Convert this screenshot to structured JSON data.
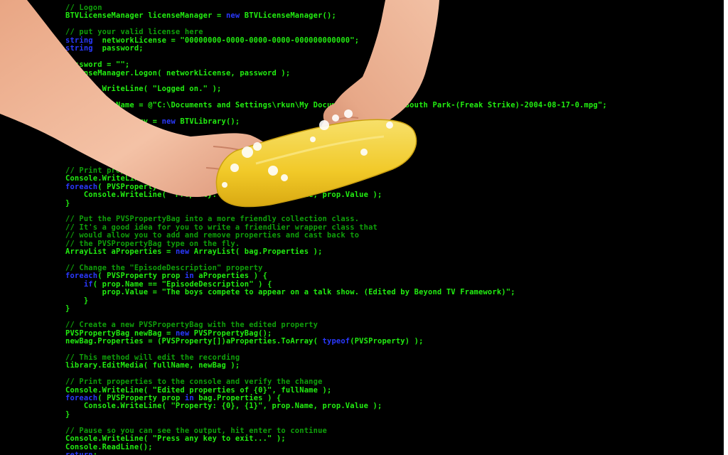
{
  "colors": {
    "background": "#000000",
    "keyword": "#2a39ff",
    "identifier": "#22ee11",
    "comment": "#0fa10a",
    "skin": "#f1b89a",
    "sponge": "#f3d23a"
  },
  "illustration": {
    "hands_icon": "hands-icon",
    "sponge_icon": "sponge-icon",
    "foam_icon": "foam-icon"
  },
  "code_lines": [
    [
      [
        "cm",
        "// Logon"
      ]
    ],
    [
      [
        "id",
        "BTVLicenseManager licenseManager = "
      ],
      [
        "kw",
        "new"
      ],
      [
        "id",
        " BTVLicenseManager();"
      ]
    ],
    [
      [
        "id",
        ""
      ]
    ],
    [
      [
        "cm",
        "// put your valid license here"
      ]
    ],
    [
      [
        "kw",
        "string"
      ],
      [
        "id",
        "  networkLicense = \"00000000-0000-0000-0000-000000000000\";"
      ]
    ],
    [
      [
        "kw",
        "string"
      ],
      [
        "id",
        "  password;"
      ]
    ],
    [
      [
        "id",
        ""
      ]
    ],
    [
      [
        "id",
        "password = \"\";"
      ]
    ],
    [
      [
        "id",
        "licenseManager.Logon( networkLicense, password );"
      ]
    ],
    [
      [
        "id",
        ""
      ]
    ],
    [
      [
        "id",
        "Console.WriteLine( \"Logged on.\" );"
      ]
    ],
    [
      [
        "id",
        ""
      ]
    ],
    [
      [
        "kw",
        "string"
      ],
      [
        "id",
        " fullName = @\"C:\\Documents and Settings\\rkun\\My Documents\\My Videos\\South Park-(Freak Strike)-2004-08-17-0.mpg\";"
      ]
    ],
    [
      [
        "id",
        ""
      ]
    ],
    [
      [
        "id",
        "BTVLibrary library = "
      ],
      [
        "kw",
        "new"
      ],
      [
        "id",
        " BTVLibrary();"
      ]
    ],
    [
      [
        "id",
        ""
      ]
    ],
    [
      [
        "id",
        ""
      ]
    ],
    [
      [
        "id",
        ""
      ]
    ],
    [
      [
        "id",
        ""
      ]
    ],
    [
      [
        "id",
        ""
      ]
    ],
    [
      [
        "cm",
        "// Print properties to the console"
      ]
    ],
    [
      [
        "id",
        "Console.WriteLine( \"Properties of {0}\", fullName );"
      ]
    ],
    [
      [
        "kw",
        "foreach"
      ],
      [
        "id",
        "( PVSProperty prop "
      ],
      [
        "kw",
        "in"
      ],
      [
        "id",
        " bag.Properties ) {"
      ]
    ],
    [
      [
        "id",
        "    Console.WriteLine( \"Property: {0}, {1}\", prop.Name, prop.Value );"
      ]
    ],
    [
      [
        "id",
        "}"
      ]
    ],
    [
      [
        "id",
        ""
      ]
    ],
    [
      [
        "cm",
        "// Put the PVSPropertyBag into a more friendly collection class."
      ]
    ],
    [
      [
        "cm",
        "// It's a good idea for you to write a friendlier wrapper class that"
      ]
    ],
    [
      [
        "cm",
        "// would allow you to add and remove properties and cast back to"
      ]
    ],
    [
      [
        "cm",
        "// the PVSPropertyBag type on the fly."
      ]
    ],
    [
      [
        "id",
        "ArrayList aProperties = "
      ],
      [
        "kw",
        "new"
      ],
      [
        "id",
        " ArrayList( bag.Properties );"
      ]
    ],
    [
      [
        "id",
        ""
      ]
    ],
    [
      [
        "cm",
        "// Change the \"EpisodeDescription\" property"
      ]
    ],
    [
      [
        "kw",
        "foreach"
      ],
      [
        "id",
        "( PVSProperty prop "
      ],
      [
        "kw",
        "in"
      ],
      [
        "id",
        " aProperties ) {"
      ]
    ],
    [
      [
        "id",
        "    "
      ],
      [
        "kw",
        "if"
      ],
      [
        "id",
        "( prop.Name == \"EpisodeDescription\" ) {"
      ]
    ],
    [
      [
        "id",
        "        prop.Value = \"The boys compete to appear on a talk show. (Edited by Beyond TV Framework)\";"
      ]
    ],
    [
      [
        "id",
        "    }"
      ]
    ],
    [
      [
        "id",
        "}"
      ]
    ],
    [
      [
        "id",
        ""
      ]
    ],
    [
      [
        "cm",
        "// Create a new PVSPropertyBag with the edited property"
      ]
    ],
    [
      [
        "id",
        "PVSPropertyBag newBag = "
      ],
      [
        "kw",
        "new"
      ],
      [
        "id",
        " PVSPropertyBag();"
      ]
    ],
    [
      [
        "id",
        "newBag.Properties = (PVSProperty[])aProperties.ToArray( "
      ],
      [
        "kw",
        "typeof"
      ],
      [
        "id",
        "(PVSProperty) );"
      ]
    ],
    [
      [
        "id",
        ""
      ]
    ],
    [
      [
        "cm",
        "// This method will edit the recording"
      ]
    ],
    [
      [
        "id",
        "library.EditMedia( fullName, newBag );"
      ]
    ],
    [
      [
        "id",
        ""
      ]
    ],
    [
      [
        "cm",
        "// Print properties to the console and verify the change"
      ]
    ],
    [
      [
        "id",
        "Console.WriteLine( \"Edited properties of {0}\", fullName );"
      ]
    ],
    [
      [
        "kw",
        "foreach"
      ],
      [
        "id",
        "( PVSProperty prop "
      ],
      [
        "kw",
        "in"
      ],
      [
        "id",
        " bag.Properties ) {"
      ]
    ],
    [
      [
        "id",
        "    Console.WriteLine( \"Property: {0}, {1}\", prop.Name, prop.Value );"
      ]
    ],
    [
      [
        "id",
        "}"
      ]
    ],
    [
      [
        "id",
        ""
      ]
    ],
    [
      [
        "cm",
        "// Pause so you can see the output, hit enter to continue"
      ]
    ],
    [
      [
        "id",
        "Console.WriteLine( \"Press any key to exit...\" );"
      ]
    ],
    [
      [
        "id",
        "Console.ReadLine();"
      ]
    ],
    [
      [
        "kw",
        "return"
      ],
      [
        "id",
        ";"
      ]
    ]
  ]
}
